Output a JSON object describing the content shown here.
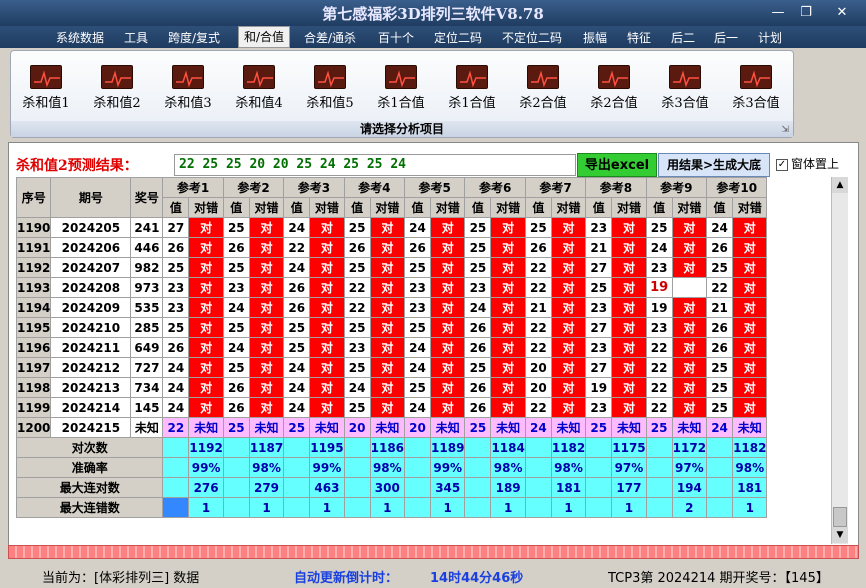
{
  "window": {
    "title": "第七感福彩3D排列三软件V8.78"
  },
  "menu": [
    "系统数据",
    "工具",
    "跨度/复式",
    "和/合值",
    "合差/通杀",
    "百十个",
    "定位二码",
    "不定位二码",
    "振幅",
    "特征",
    "后二",
    "后一",
    "计划"
  ],
  "menu_active": 3,
  "ribbon": {
    "buttons": [
      "杀和值1",
      "杀和值2",
      "杀和值3",
      "杀和值4",
      "杀和值5",
      "杀1合值",
      "杀1合值",
      "杀2合值",
      "杀2合值",
      "杀3合值",
      "杀3合值"
    ],
    "footer": "请选择分析项目"
  },
  "result": {
    "label": "杀和值2预测结果：",
    "values": "22  25  25  20  20  25  24  25  25  24",
    "export_label": "导出excel",
    "generate_label": "用结果>生成大底",
    "pin_label": "窗体置上",
    "pin_checked": "✓"
  },
  "table": {
    "headers": {
      "index": "序号",
      "issue": "期号",
      "prize": "奖号",
      "value": "值",
      "verdict": "对错"
    },
    "refs": [
      "参考1",
      "参考2",
      "参考3",
      "参考4",
      "参考5",
      "参考6",
      "参考7",
      "参考8",
      "参考9",
      "参考10"
    ],
    "ok_text": "对",
    "rows": [
      {
        "idx": "1190",
        "issue": "2024205",
        "prize": "241",
        "vals": [
          "27",
          "25",
          "24",
          "25",
          "24",
          "25",
          "25",
          "23",
          "25",
          "24"
        ]
      },
      {
        "idx": "1191",
        "issue": "2024206",
        "prize": "446",
        "vals": [
          "26",
          "26",
          "22",
          "26",
          "26",
          "25",
          "26",
          "21",
          "24",
          "26"
        ]
      },
      {
        "idx": "1192",
        "issue": "2024207",
        "prize": "982",
        "vals": [
          "25",
          "25",
          "24",
          "25",
          "25",
          "25",
          "22",
          "27",
          "23",
          "25"
        ]
      },
      {
        "idx": "1193",
        "issue": "2024208",
        "prize": "973",
        "vals": [
          "23",
          "23",
          "26",
          "22",
          "23",
          "23",
          "22",
          "25",
          "19",
          "22"
        ],
        "miss": 8
      },
      {
        "idx": "1194",
        "issue": "2024209",
        "prize": "535",
        "vals": [
          "23",
          "24",
          "26",
          "22",
          "23",
          "24",
          "21",
          "23",
          "19",
          "21"
        ]
      },
      {
        "idx": "1195",
        "issue": "2024210",
        "prize": "285",
        "vals": [
          "25",
          "25",
          "25",
          "25",
          "25",
          "26",
          "22",
          "27",
          "23",
          "26"
        ]
      },
      {
        "idx": "1196",
        "issue": "2024211",
        "prize": "649",
        "vals": [
          "26",
          "24",
          "25",
          "23",
          "24",
          "26",
          "22",
          "23",
          "22",
          "26"
        ]
      },
      {
        "idx": "1197",
        "issue": "2024212",
        "prize": "727",
        "vals": [
          "24",
          "25",
          "24",
          "25",
          "24",
          "25",
          "20",
          "27",
          "22",
          "25"
        ]
      },
      {
        "idx": "1198",
        "issue": "2024213",
        "prize": "734",
        "vals": [
          "24",
          "26",
          "24",
          "24",
          "25",
          "26",
          "20",
          "19",
          "22",
          "25"
        ]
      },
      {
        "idx": "1199",
        "issue": "2024214",
        "prize": "145",
        "vals": [
          "24",
          "26",
          "24",
          "25",
          "24",
          "26",
          "22",
          "23",
          "22",
          "25"
        ]
      }
    ],
    "pending": {
      "idx": "1200",
      "issue": "2024215",
      "prize": "未知",
      "vals": [
        "22",
        "25",
        "25",
        "20",
        "20",
        "25",
        "24",
        "25",
        "25",
        "24"
      ],
      "unknown": "未知"
    },
    "stats": [
      {
        "label": "对次数",
        "vals": [
          "1192",
          "1187",
          "1195",
          "1186",
          "1189",
          "1184",
          "1182",
          "1175",
          "1172",
          "1182"
        ]
      },
      {
        "label": "准确率",
        "vals": [
          "99%",
          "98%",
          "99%",
          "98%",
          "99%",
          "98%",
          "98%",
          "97%",
          "97%",
          "98%"
        ]
      },
      {
        "label": "最大连对数",
        "vals": [
          "276",
          "279",
          "463",
          "300",
          "345",
          "189",
          "181",
          "177",
          "194",
          "181"
        ]
      },
      {
        "label": "最大连错数",
        "vals": [
          "1",
          "1",
          "1",
          "1",
          "1",
          "1",
          "1",
          "1",
          "2",
          "1"
        ]
      }
    ]
  },
  "status": {
    "current": "当前为：[体彩排列三] 数据",
    "countdown_label": "自动更新倒计时：",
    "countdown": "14时44分46秒",
    "issue_info": "TCP3第 2024214 期开奖号：【145】"
  },
  "colors": {
    "ok": "#ff0000",
    "pending": "#ffbbff",
    "stats": "#66ffff",
    "excel": "#33cc33"
  }
}
